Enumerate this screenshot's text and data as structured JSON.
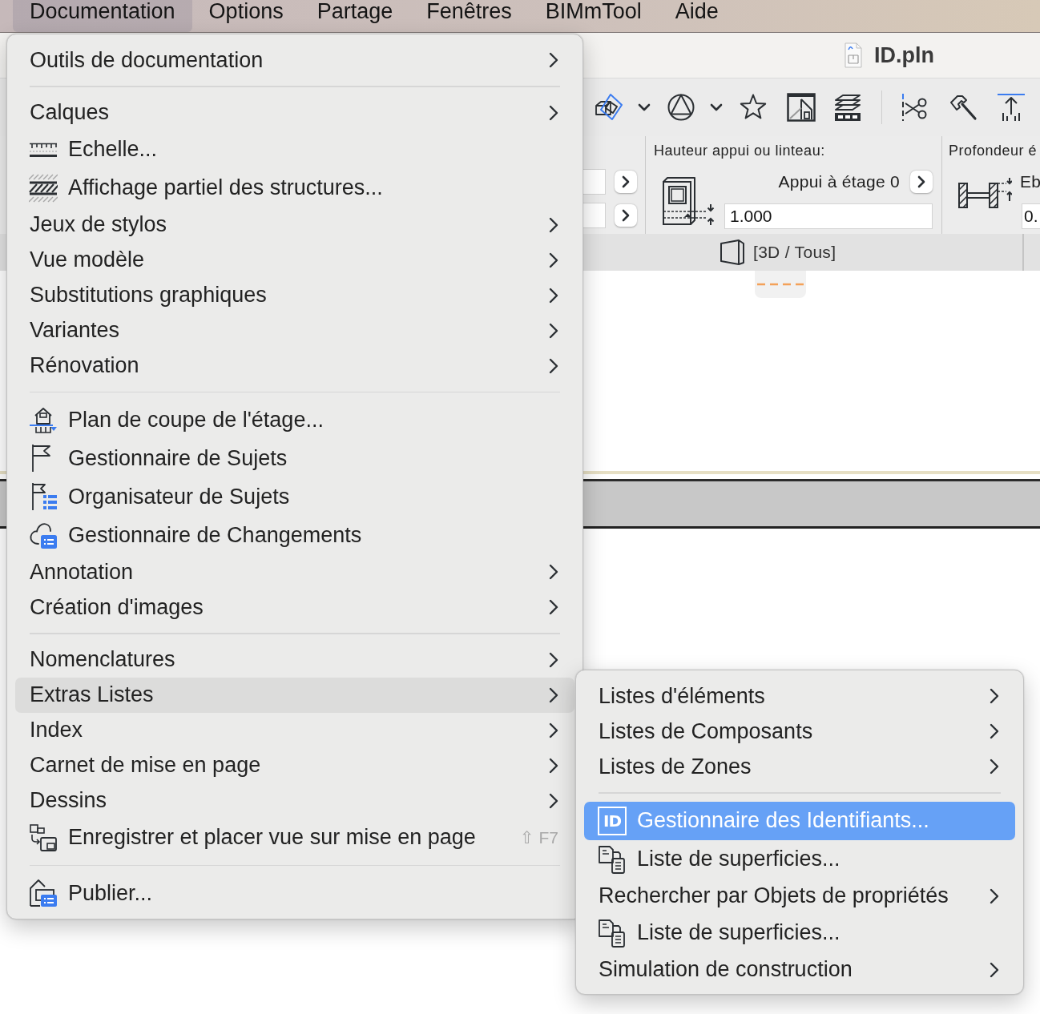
{
  "menu_bar": {
    "items": [
      {
        "label": "Documentation",
        "selected": true
      },
      {
        "label": "Options",
        "selected": false
      },
      {
        "label": "Partage",
        "selected": false
      },
      {
        "label": "Fenêtres",
        "selected": false
      },
      {
        "label": "BIMmTool",
        "selected": false
      },
      {
        "label": "Aide",
        "selected": false
      }
    ]
  },
  "window": {
    "title": "ID.pln"
  },
  "info_box": {
    "sill": {
      "label": "Hauteur appui ou linteau:",
      "reference": "Appui à étage 0",
      "value": "1.000"
    },
    "depth": {
      "label": "Profondeur é",
      "reference": "Eb",
      "value": "0."
    }
  },
  "view_bar": {
    "label": "[3D / Tous]"
  },
  "menu": {
    "sections": [
      {
        "items": [
          {
            "kind": "text",
            "label": "Outils de documentation",
            "submenu": true,
            "selected": false
          }
        ]
      },
      {
        "items": [
          {
            "kind": "text",
            "label": "Calques",
            "submenu": true,
            "selected": false
          },
          {
            "kind": "icon",
            "label": "Echelle...",
            "submenu": false,
            "selected": false
          },
          {
            "kind": "icon",
            "label": "Affichage partiel des structures...",
            "submenu": false,
            "selected": false
          },
          {
            "kind": "text",
            "label": "Jeux de stylos",
            "submenu": true,
            "selected": false
          },
          {
            "kind": "text",
            "label": "Vue modèle",
            "submenu": true,
            "selected": false
          },
          {
            "kind": "text",
            "label": "Substitutions graphiques",
            "submenu": true,
            "selected": false
          },
          {
            "kind": "text",
            "label": "Variantes",
            "submenu": true,
            "selected": false
          },
          {
            "kind": "text",
            "label": "Rénovation",
            "submenu": true,
            "selected": false
          }
        ]
      },
      {
        "items": [
          {
            "kind": "icon",
            "label": "Plan de coupe de l'étage...",
            "submenu": false,
            "selected": false
          },
          {
            "kind": "icon",
            "label": "Gestionnaire de Sujets",
            "submenu": false,
            "selected": false
          },
          {
            "kind": "icon",
            "label": "Organisateur de Sujets",
            "submenu": false,
            "selected": false
          },
          {
            "kind": "icon",
            "label": "Gestionnaire de Changements",
            "submenu": false,
            "selected": false
          },
          {
            "kind": "text",
            "label": "Annotation",
            "submenu": true,
            "selected": false
          },
          {
            "kind": "text",
            "label": "Création d'images",
            "submenu": true,
            "selected": false
          }
        ]
      },
      {
        "items": [
          {
            "kind": "text",
            "label": "Nomenclatures",
            "submenu": true,
            "selected": false
          },
          {
            "kind": "text",
            "label": "Extras Listes",
            "submenu": true,
            "selected": true
          },
          {
            "kind": "text",
            "label": "Index",
            "submenu": true,
            "selected": false
          },
          {
            "kind": "text",
            "label": "Carnet de mise en page",
            "submenu": true,
            "selected": false
          },
          {
            "kind": "text",
            "label": "Dessins",
            "submenu": true,
            "selected": false
          },
          {
            "kind": "icon",
            "label": "Enregistrer et placer vue sur mise en page",
            "shortcut": "⇧ F7",
            "submenu": false,
            "selected": false
          }
        ]
      },
      {
        "items": [
          {
            "kind": "icon",
            "label": "Publier...",
            "submenu": false,
            "selected": false
          }
        ]
      }
    ]
  },
  "submenu": {
    "sections": [
      {
        "items": [
          {
            "kind": "text",
            "label": "Listes d'éléments",
            "submenu": true,
            "selected": false
          },
          {
            "kind": "text",
            "label": "Listes de Composants",
            "submenu": true,
            "selected": false
          },
          {
            "kind": "text",
            "label": "Listes de Zones",
            "submenu": true,
            "selected": false
          }
        ]
      },
      {
        "items": [
          {
            "kind": "badge",
            "badge": "ID",
            "label": "Gestionnaire des Identifiants...",
            "submenu": false,
            "selected": true
          },
          {
            "kind": "icon",
            "label": "Liste de superficies...",
            "submenu": false,
            "selected": false
          },
          {
            "kind": "text",
            "label": "Rechercher par Objets de propriétés",
            "submenu": true,
            "selected": false
          },
          {
            "kind": "icon",
            "label": "Liste de superficies...",
            "submenu": false,
            "selected": false
          },
          {
            "kind": "text",
            "label": "Simulation de construction",
            "submenu": true,
            "selected": false
          }
        ]
      }
    ]
  }
}
